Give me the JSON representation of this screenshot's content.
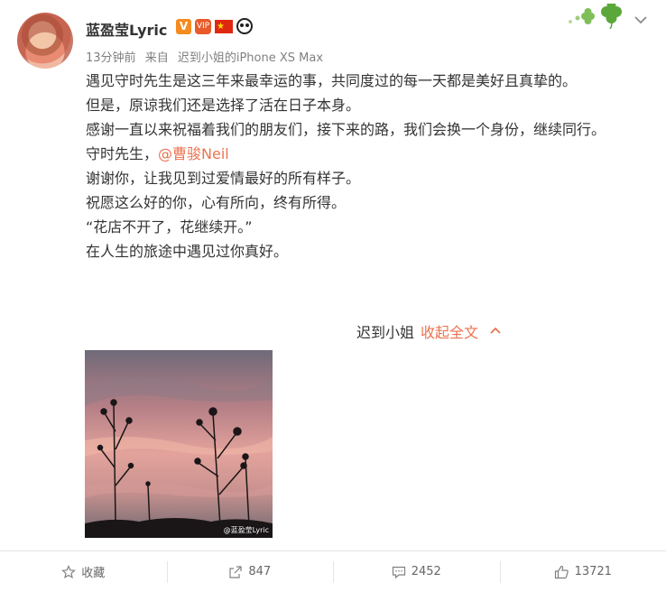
{
  "user": {
    "name": "蓝盈莹Lyric",
    "verified_badge": "V",
    "vip_badge": "VIP",
    "flag_badge": "★"
  },
  "meta": {
    "time": "13分钟前",
    "from_label": "来自",
    "source": "迟到小姐的iPhone XS Max"
  },
  "post": {
    "lines": [
      "遇见守时先生是这三年来最幸运的事，共同度过的每一天都是美好且真挚的。",
      "但是，原谅我们还是选择了活在日子本身。",
      "感谢一直以来祝福着我们的朋友们，接下来的路，我们会换一个身份，继续同行。"
    ],
    "mention_prefix": "守时先生，",
    "mention": "@曹骏Neil",
    "lines2": [
      "谢谢你，让我见到过爱情最好的所有样子。",
      "祝愿这么好的你，心有所向，终有所得。",
      "“花店不开了，花继续开。”",
      "在人生的旅途中遇见过你真好。"
    ]
  },
  "collapse": {
    "author": "迟到小姐",
    "link": "收起全文"
  },
  "photo": {
    "watermark": "@蓝盈莹Lyric"
  },
  "actions": {
    "favorite": "收藏",
    "repost": "847",
    "comment": "2452",
    "like": "13721"
  },
  "icons": {
    "menu": "chevron-down-icon",
    "decoration": "clover-icon",
    "favorite": "star-icon",
    "repost": "share-arrow-icon",
    "comment": "comment-bubble-icon",
    "like": "thumbs-up-icon"
  },
  "colors": {
    "link": "#eb7350",
    "meta": "#808080",
    "text": "#333333"
  }
}
